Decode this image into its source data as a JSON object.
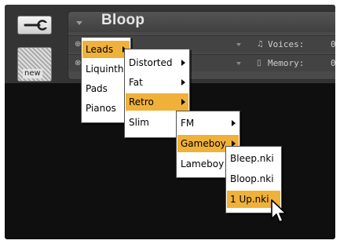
{
  "instrument": {
    "name": "Bloop",
    "voices_label": "Voices:",
    "voices_value": "0",
    "memory_label": "Memory:",
    "memory_value": "0"
  },
  "buttons": {
    "wrench_icon": "wrench-icon",
    "new_label": "new"
  },
  "menus": {
    "level1": [
      "Leads",
      "Liquinth",
      "Pads",
      "Pianos"
    ],
    "level2": [
      "Distorted",
      "Fat",
      "Retro",
      "Slim"
    ],
    "level3": [
      "FM",
      "Gameboy",
      "Lameboy"
    ],
    "level4": [
      "Bleep.nki",
      "Bloop.nki",
      "1 Up.nki"
    ]
  },
  "colors": {
    "highlight": "#f0b13a",
    "background": "#0f0f0f",
    "panel": "#4a4a4a"
  }
}
